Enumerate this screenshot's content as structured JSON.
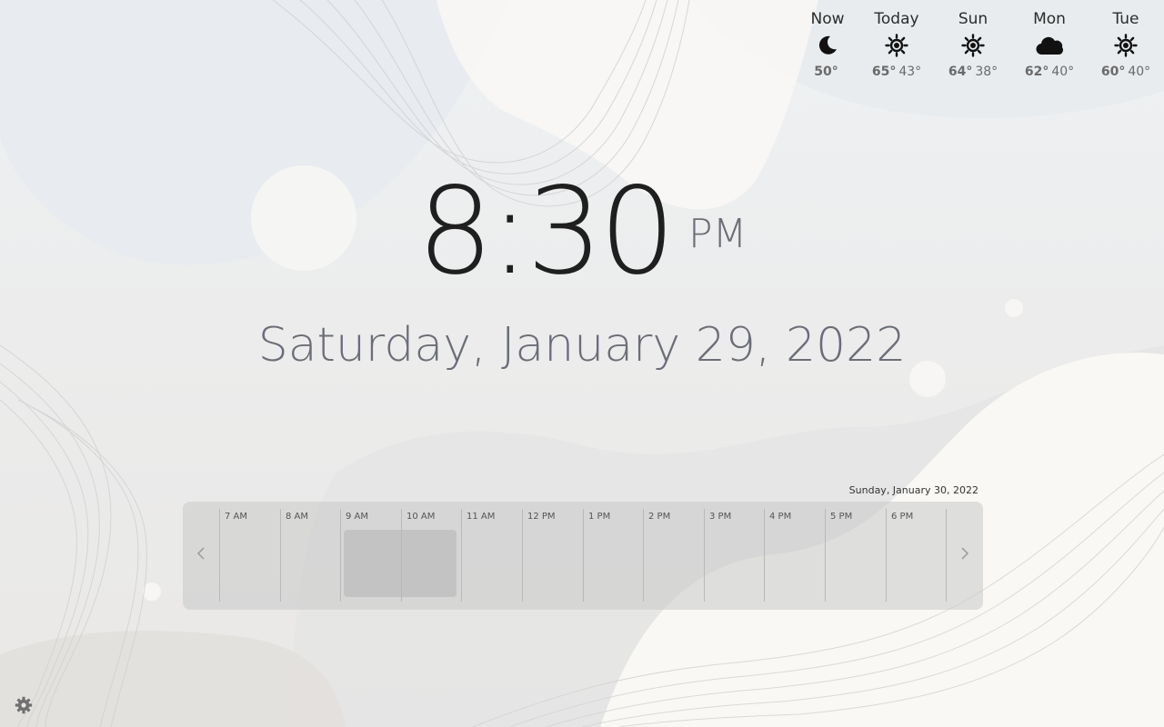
{
  "weather": [
    {
      "day": "Now",
      "icon": "moon-icon",
      "high": "50°",
      "low": ""
    },
    {
      "day": "Today",
      "icon": "sun-icon",
      "high": "65°",
      "low": "43°"
    },
    {
      "day": "Sun",
      "icon": "sun-icon",
      "high": "64°",
      "low": "38°"
    },
    {
      "day": "Mon",
      "icon": "cloud-icon",
      "high": "62°",
      "low": "40°"
    },
    {
      "day": "Tue",
      "icon": "sun-icon",
      "high": "60°",
      "low": "40°"
    }
  ],
  "clock": {
    "time": "8:30",
    "ampm": "PM",
    "date": "Saturday, January 29, 2022"
  },
  "timeline": {
    "date_label": "Sunday, January 30, 2022",
    "prev_icon": "chevron-left-icon",
    "next_icon": "chevron-right-icon",
    "hours": [
      "7 AM",
      "8 AM",
      "9 AM",
      "10 AM",
      "11 AM",
      "12 PM",
      "1 PM",
      "2 PM",
      "3 PM",
      "4 PM",
      "5 PM",
      "6 PM"
    ]
  },
  "settings": {
    "icon": "gear-icon"
  },
  "colors": {
    "text_dark": "#1f1f1f",
    "text_muted": "#6b6e76",
    "timeline_bg": "#cfcfcf",
    "event": "#c3c3c3"
  }
}
